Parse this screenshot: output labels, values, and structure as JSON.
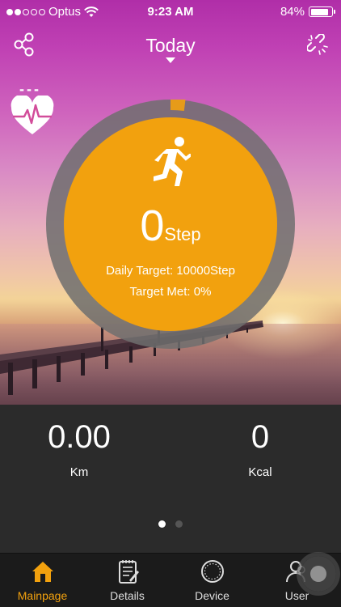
{
  "status_bar": {
    "carrier": "Optus",
    "time": "9:23 AM",
    "battery": "84%",
    "battery_level": 0.84,
    "signal_bars_filled": 2,
    "signal_bars_total": 5
  },
  "header": {
    "title": "Today",
    "share_icon": "share-icon",
    "link_icon": "unlink-icon"
  },
  "heart_rate": {
    "value": "---",
    "icon": "heart-rate-icon"
  },
  "progress": {
    "activity_icon": "running-icon",
    "steps": "0",
    "unit": "Step",
    "daily_target": "Daily Target: 10000Step",
    "target_met": "Target Met: 0%"
  },
  "stats": {
    "distance": {
      "value": "0.00",
      "label": "Km"
    },
    "calories": {
      "value": "0",
      "label": "Kcal"
    }
  },
  "pager": {
    "pages": 2,
    "current": 1
  },
  "tabs": [
    {
      "label": "Mainpage",
      "icon": "home-icon",
      "active": true
    },
    {
      "label": "Details",
      "icon": "notepad-icon",
      "active": false
    },
    {
      "label": "Device",
      "icon": "watch-icon",
      "active": false
    },
    {
      "label": "User",
      "icon": "users-icon",
      "active": false
    }
  ],
  "colors": {
    "accent": "#f2a10e",
    "ring": "#6e6e6e",
    "panel": "#2b2b2b",
    "tabbar": "#1b1b1b"
  }
}
